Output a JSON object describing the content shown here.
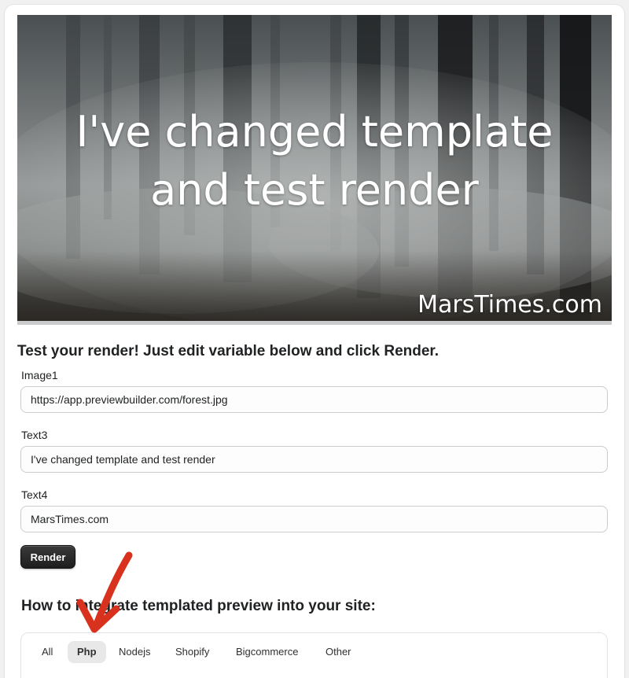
{
  "hero": {
    "title_line1": "I've changed template",
    "title_line2": "and test render",
    "brand": "MarsTimes.com"
  },
  "form": {
    "heading": "Test your render! Just edit variable below and click Render.",
    "fields": [
      {
        "label": "Image1",
        "value": "https://app.previewbuilder.com/forest.jpg"
      },
      {
        "label": "Text3",
        "value": "I've changed template and test render"
      },
      {
        "label": "Text4",
        "value": "MarsTimes.com"
      }
    ],
    "render_label": "Render"
  },
  "integration": {
    "heading": "How to integrate templated preview into your site:",
    "tabs": [
      {
        "label": "All"
      },
      {
        "label": "Php"
      },
      {
        "label": "Nodejs"
      },
      {
        "label": "Shopify"
      },
      {
        "label": "Bigcommerce"
      },
      {
        "label": "Other"
      }
    ],
    "active_tab": "Php"
  },
  "colors": {
    "annotation_arrow": "#d8321f",
    "button_bg": "#1e1e1e"
  }
}
